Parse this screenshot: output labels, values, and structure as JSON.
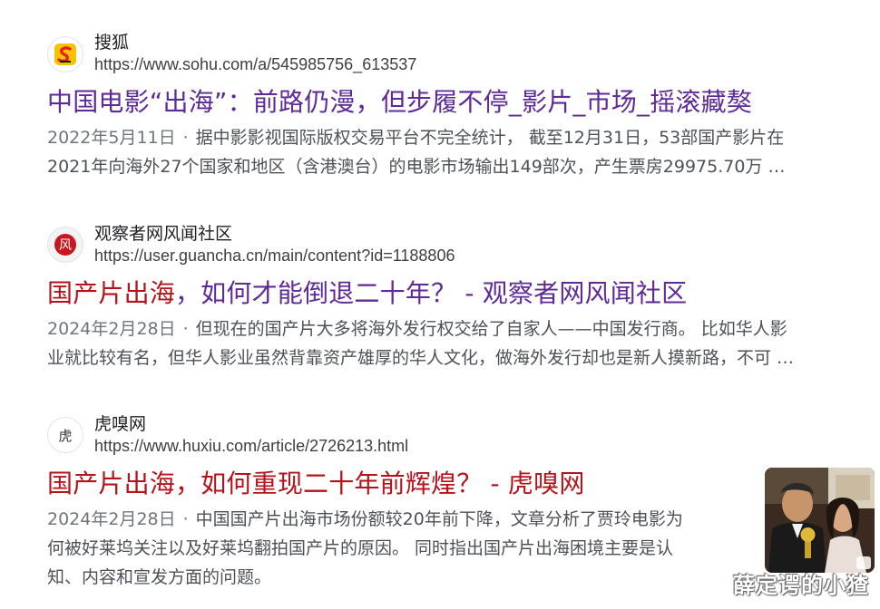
{
  "results": [
    {
      "site_name": "搜狐",
      "url": "https://www.sohu.com/a/545985756_613537",
      "title": "中国电影“出海”：前路仍漫，但步履不停_影片_市场_摇滚藏獒",
      "date": "2022年5月11日",
      "separator": "·",
      "snippet_line1": "据中影影视国际版权交易平台不完全统计， 截至12月31日，53部国产影片在",
      "snippet_line2": "2021年向海外27个国家和地区（含港澳台）的电影市场输出149部次，产生票房29975.70万 …",
      "favicon_icon": "sohu-logo-icon"
    },
    {
      "site_name": "观察者网风闻社区",
      "url": "https://user.guancha.cn/main/content?id=1188806",
      "title_highlight": "国产片出海",
      "title_rest": "，如何才能倒退二十年？ - 观察者网风闻社区",
      "date": "2024年2月28日",
      "separator": "·",
      "snippet_line1": "但现在的国产片大多将海外发行权交给了自家人——中国发行商。 比如华人影",
      "snippet_line2": "业就比较有名，但华人影业虽然背靠资产雄厚的华人文化，做海外发行却也是新人摸新路，不可 …",
      "favicon_char": "风",
      "favicon_icon": "fengwen-logo-icon"
    },
    {
      "site_name": "虎嗅网",
      "url": "https://www.huxiu.com/article/2726213.html",
      "title_highlight": "国产片出海",
      "title_rest": "，如何重现二十年前辉煌？ - 虎嗅网",
      "date": "2024年2月28日",
      "separator": "·",
      "snippet_line1": "中国国产片出海市场份额较20年前下降，文章分析了贾玲电影为",
      "snippet_line2": "何被好莱坞关注以及好莱坞翻拍国产片的原因。 同时指出国产片出海困境主要是认",
      "snippet_line3": "知、内容和宣发方面的问题。",
      "favicon_char": "虎",
      "favicon_icon": "huxiu-logo-icon"
    }
  ],
  "thumbnail": {
    "icon": "photo-thumbnail",
    "overlay_icon": "image-expand-icon"
  },
  "watermark": "薛定谔的小猹",
  "colors": {
    "visited_title": "#5d2a96",
    "highlight_title": "#b5121b",
    "snippet_text": "#4d5156"
  }
}
